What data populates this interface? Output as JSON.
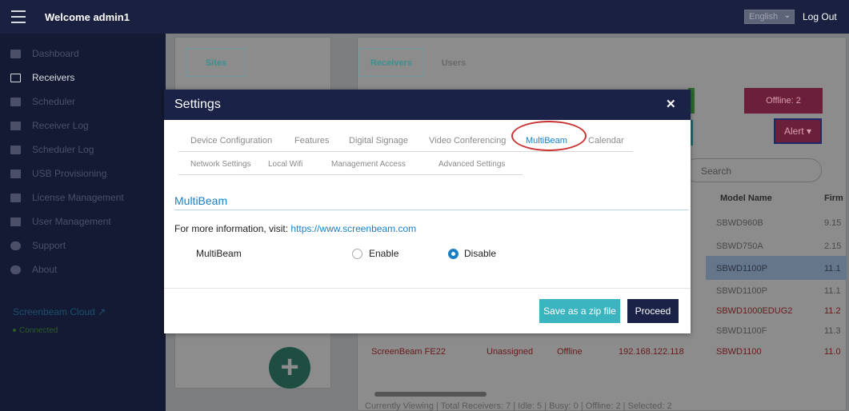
{
  "topbar": {
    "welcome": "Welcome admin1",
    "language": "English",
    "logout": "Log Out"
  },
  "sidebar": {
    "items": [
      {
        "label": "Dashboard",
        "icon": "dashboard-icon"
      },
      {
        "label": "Receivers",
        "icon": "cast-icon"
      },
      {
        "label": "Scheduler",
        "icon": "calendar-icon"
      },
      {
        "label": "Receiver Log",
        "icon": "log-icon"
      },
      {
        "label": "Scheduler Log",
        "icon": "folder-icon"
      },
      {
        "label": "USB Provisioning",
        "icon": "usb-icon"
      },
      {
        "label": "License Management",
        "icon": "license-icon"
      },
      {
        "label": "User Management",
        "icon": "users-icon"
      },
      {
        "label": "Support",
        "icon": "info-icon"
      },
      {
        "label": "About",
        "icon": "help-icon"
      }
    ],
    "cloud_label": "Screenbeam Cloud",
    "status": "Connected"
  },
  "background": {
    "sites_tab": "Sites",
    "receivers_tab": "Receivers",
    "users_tab": "Users",
    "offline_chip": "Offline: 2",
    "alert_button": "Alert",
    "search_placeholder": "Search",
    "col_model": "Model Name",
    "col_firmware": "Firm",
    "models": [
      "SBWD960B",
      "SBWD750A",
      "SBWD1100P",
      "SBWD1100P",
      "SBWD1000EDUG2",
      "SBWD1100F",
      "SBWD1100"
    ],
    "firmware": [
      "9.15",
      "2.15",
      "11.1",
      "11.1",
      "11.2",
      "11.3",
      "11.0"
    ],
    "last_row": {
      "name": "ScreenBeam FE22",
      "site": "Unassigned",
      "status": "Offline",
      "ip": "192.168.122.118"
    },
    "footer": "Currently Viewing | Total Receivers: 7 | Idle: 5 | Busy: 0 | Offline: 2 | Selected: 2"
  },
  "modal": {
    "title": "Settings",
    "close_icon": "close-icon",
    "tabs_row1": [
      "Device Configuration",
      "Features",
      "Digital Signage",
      "Video Conferencing",
      "MultiBeam",
      "Calendar"
    ],
    "tabs_row2": [
      "Network Settings",
      "Local Wifi",
      "Management Access",
      "Advanced Settings"
    ],
    "section_title": "MultiBeam",
    "info_text": "For more information, visit:",
    "info_link": "https://www.screenbeam.com",
    "multibeam_label": "MultiBeam",
    "enable_label": "Enable",
    "disable_label": "Disable",
    "selected_option": "Disable",
    "zip_button": "Save as a zip file",
    "proceed_button": "Proceed"
  },
  "colors": {
    "navy": "#1b2248",
    "accent": "#1a7fc4",
    "teal": "#3ab5c0",
    "highlight_ring": "#c83232"
  }
}
